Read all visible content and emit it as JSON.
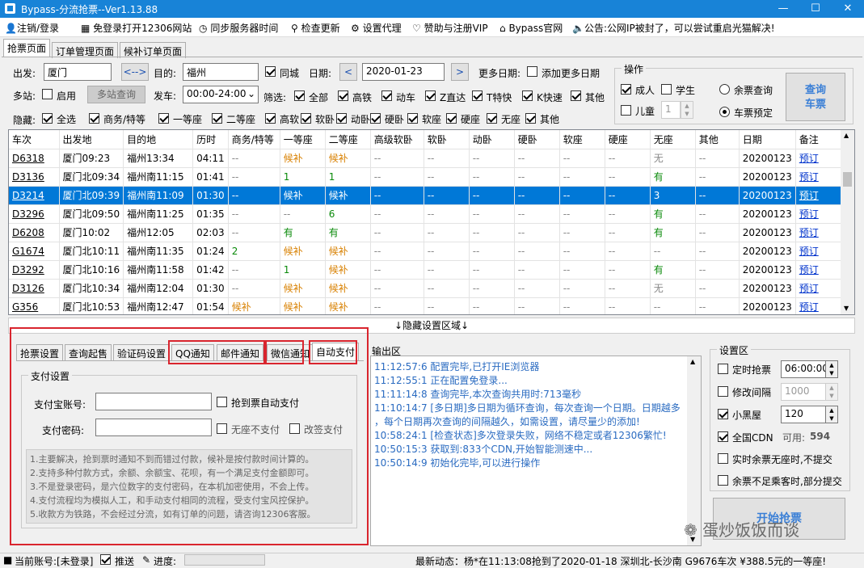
{
  "window": {
    "title": "Bypass-分流抢票--Ver1.13.88",
    "min": "—",
    "max": "☐",
    "close": "✕"
  },
  "menu": {
    "items": [
      "注销/登录",
      "免登录打开12306网站",
      "同步服务器时间",
      "检查更新",
      "设置代理",
      "赞助与注册VIP",
      "Bypass官网",
      "公告:公网IP被封了，可以尝试重启光猫解决!"
    ],
    "icons": [
      "user-icon",
      "qr-icon",
      "clock-icon",
      "search-icon",
      "gear-icon",
      "heart-icon",
      "home-icon",
      "speaker-icon"
    ]
  },
  "tabs": [
    "抢票页面",
    "订单管理页面",
    "候补订单页面"
  ],
  "query": {
    "from_label": "出发:",
    "from_value": "厦门",
    "swap": "<-->",
    "to_label": "目的:",
    "to_value": "福州",
    "same_city": "同城",
    "date_label": "日期:",
    "date_value": "2020-01-23",
    "prev": "<",
    "next": ">",
    "more_dates_label": "更多日期:",
    "add_more_dates": "添加更多日期",
    "multi_station_label": "多站:",
    "enable": "启用",
    "multi_station_query": "多站查询",
    "depart_label": "发车:",
    "depart_value": "00:00-24:00",
    "filter_label": "筛选:",
    "filters": [
      "全部",
      "高铁",
      "动车",
      "Z直达",
      "T特快",
      "K快速",
      "其他"
    ],
    "hide_label": "隐藏:",
    "hides": [
      "全选",
      "商务/特等",
      "一等座",
      "二等座",
      "高软",
      "软卧",
      "动卧",
      "硬卧",
      "软座",
      "硬座",
      "无座",
      "其他"
    ]
  },
  "operation": {
    "title": "操作",
    "adult": "成人",
    "student": "学生",
    "child": "儿童",
    "child_count": "1",
    "remaining_query": "余票查询",
    "ticket_book": "车票预定",
    "query_btn": "查询\n车票"
  },
  "grid": {
    "headers": [
      "车次",
      "出发地",
      "目的地",
      "历时",
      "商务/特等",
      "一等座",
      "二等座",
      "高级软卧",
      "软卧",
      "动卧",
      "硬卧",
      "软座",
      "硬座",
      "无座",
      "其他",
      "日期",
      "备注"
    ],
    "rows": [
      {
        "no": "D6318",
        "from": "厦门09:23",
        "to": "福州13:34",
        "dur": "04:11",
        "c4": "--",
        "c5": "候补",
        "c6": "候补",
        "c7": "--",
        "c8": "--",
        "c9": "--",
        "c10": "--",
        "c11": "--",
        "c12": "--",
        "c13": "无",
        "c14": "--",
        "date": "20200123",
        "note": "预订",
        "sel": false
      },
      {
        "no": "D3136",
        "from": "厦门北09:34",
        "to": "福州南11:15",
        "dur": "01:41",
        "c4": "--",
        "c5": "1",
        "c6": "1",
        "c7": "--",
        "c8": "--",
        "c9": "--",
        "c10": "--",
        "c11": "--",
        "c12": "--",
        "c13": "有",
        "c14": "--",
        "date": "20200123",
        "note": "预订",
        "sel": false
      },
      {
        "no": "D3214",
        "from": "厦门北09:39",
        "to": "福州南11:09",
        "dur": "01:30",
        "c4": "--",
        "c5": "候补",
        "c6": "候补",
        "c7": "--",
        "c8": "--",
        "c9": "--",
        "c10": "--",
        "c11": "--",
        "c12": "--",
        "c13": "3",
        "c14": "--",
        "date": "20200123",
        "note": "预订",
        "sel": true
      },
      {
        "no": "D3296",
        "from": "厦门北09:50",
        "to": "福州南11:25",
        "dur": "01:35",
        "c4": "--",
        "c5": "--",
        "c6": "6",
        "c7": "--",
        "c8": "--",
        "c9": "--",
        "c10": "--",
        "c11": "--",
        "c12": "--",
        "c13": "有",
        "c14": "--",
        "date": "20200123",
        "note": "预订",
        "sel": false
      },
      {
        "no": "D6208",
        "from": "厦门10:02",
        "to": "福州12:05",
        "dur": "02:03",
        "c4": "--",
        "c5": "有",
        "c6": "有",
        "c7": "--",
        "c8": "--",
        "c9": "--",
        "c10": "--",
        "c11": "--",
        "c12": "--",
        "c13": "有",
        "c14": "--",
        "date": "20200123",
        "note": "预订",
        "sel": false
      },
      {
        "no": "G1674",
        "from": "厦门北10:11",
        "to": "福州南11:35",
        "dur": "01:24",
        "c4": "2",
        "c5": "候补",
        "c6": "候补",
        "c7": "--",
        "c8": "--",
        "c9": "--",
        "c10": "--",
        "c11": "--",
        "c12": "--",
        "c13": "--",
        "c14": "--",
        "date": "20200123",
        "note": "预订",
        "sel": false
      },
      {
        "no": "D3292",
        "from": "厦门北10:16",
        "to": "福州南11:58",
        "dur": "01:42",
        "c4": "--",
        "c5": "1",
        "c6": "候补",
        "c7": "--",
        "c8": "--",
        "c9": "--",
        "c10": "--",
        "c11": "--",
        "c12": "--",
        "c13": "有",
        "c14": "--",
        "date": "20200123",
        "note": "预订",
        "sel": false
      },
      {
        "no": "D3126",
        "from": "厦门北10:34",
        "to": "福州南12:04",
        "dur": "01:30",
        "c4": "--",
        "c5": "候补",
        "c6": "候补",
        "c7": "--",
        "c8": "--",
        "c9": "--",
        "c10": "--",
        "c11": "--",
        "c12": "--",
        "c13": "无",
        "c14": "--",
        "date": "20200123",
        "note": "预订",
        "sel": false
      },
      {
        "no": "G356",
        "from": "厦门北10:53",
        "to": "福州南12:47",
        "dur": "01:54",
        "c4": "候补",
        "c5": "候补",
        "c6": "候补",
        "c7": "--",
        "c8": "--",
        "c9": "--",
        "c10": "--",
        "c11": "--",
        "c12": "--",
        "c13": "--",
        "c14": "--",
        "date": "20200123",
        "note": "预订",
        "sel": false
      }
    ]
  },
  "hide_settings": "↓隐藏设置区域↓",
  "settings_tabs": [
    "抢票设置",
    "查询起售",
    "验证码设置",
    "QQ通知",
    "邮件通知",
    "微信通知",
    "自动支付"
  ],
  "payment": {
    "group": "支付设置",
    "account_label": "支付宝账号:",
    "account_value": "",
    "auto_pay": "抢到票自动支付",
    "password_label": "支付密码:",
    "password_value": "",
    "no_seat_no_pay": "无座不支付",
    "change_pay": "改签支付",
    "notes": [
      "1.主要解决，抢到票时通知不到而错过付款，候补是按付款时间计算的。",
      "2.支持多种付款方式，余额、余额宝、花呗，有一个满足支付金额即可。",
      "3.不是登录密码，是六位数字的支付密码，在本机加密使用，不会上传。",
      "4.支付流程均为模拟人工，和手动支付相同的流程，受支付宝风控保护。",
      "5.收款方为铁路，不会经过分流，如有订单的问题，请咨询12306客服。"
    ]
  },
  "output": {
    "title": "输出区",
    "lines": [
      "11:12:57:6  配置完毕,已打开IE浏览器",
      "11:12:55:1  正在配置免登录...",
      "11:11:14:8  查询完毕,本次查询共用时:713毫秒",
      "11:10:14:7  [多日期]多日期为循环查询，每次查询一个日期。日期越多",
      "  ，每个日期再次查询的间隔越久，如需设置，请尽量少的添加!",
      "10:58:24:1  [检查状态]多次登录失败，网络不稳定或者12306繁忙!",
      "10:50:15:3  获取到:833个CDN,开始智能测速中...",
      "10:50:14:9  初始化完毕,可以进行操作"
    ]
  },
  "settings": {
    "title": "设置区",
    "timed_grab": "定时抢票",
    "timed_value": "06:00:00",
    "modify_interval": "修改间隔",
    "interval_value": "1000",
    "blackroom": "小黑屋",
    "blackroom_value": "120",
    "global_cdn": "全国CDN",
    "available_label": "可用:",
    "available_value": "594",
    "realtime_no_seat": "实时余票无座时,不提交",
    "insufficient": "余票不足乘客时,部分提交",
    "start_btn": "开始抢票"
  },
  "status": {
    "account": "当前账号:[未登录]",
    "push": "推送",
    "progress": "进度:",
    "news": "最新动态：杨*在11:13:08抢到了2020-01-18 深圳北-长沙南 G9676车次 ¥388.5元的一等座!"
  },
  "watermark": "蛋炒饭饭而谈"
}
